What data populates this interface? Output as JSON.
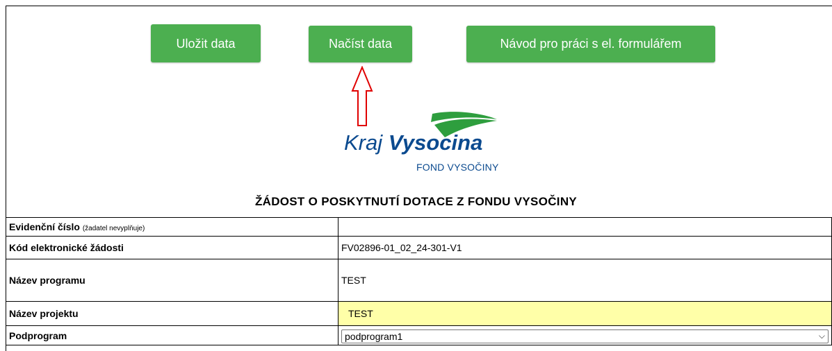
{
  "toolbar": {
    "save_label": "Uložit data",
    "load_label": "Načíst data",
    "guide_label": "Návod pro práci s el. formulářem"
  },
  "logo": {
    "word_light": "Kraj",
    "word_bold": "Vysocina",
    "subtitle": "FOND VYSOČINY"
  },
  "form": {
    "title": "ŽÁDOST O POSKYTNUTÍ DOTACE Z FONDU VYSOČINY",
    "rows": [
      {
        "label": "Evidenční číslo",
        "note": "(žadatel nevyplňuje)",
        "value": ""
      },
      {
        "label": "Kód elektronické žádosti",
        "value": "FV02896-01_02_24-301-V1"
      },
      {
        "label": "Název programu",
        "value": "TEST"
      },
      {
        "label": "Název projektu",
        "value": "TEST"
      },
      {
        "label": "Podprogram",
        "value": "podprogram1"
      }
    ]
  },
  "colors": {
    "button_green": "#4caf50",
    "logo_blue": "#0b4a8f",
    "logo_green": "#2e9e3e",
    "highlight_yellow": "#ffffa8",
    "arrow_red": "#e00000"
  }
}
